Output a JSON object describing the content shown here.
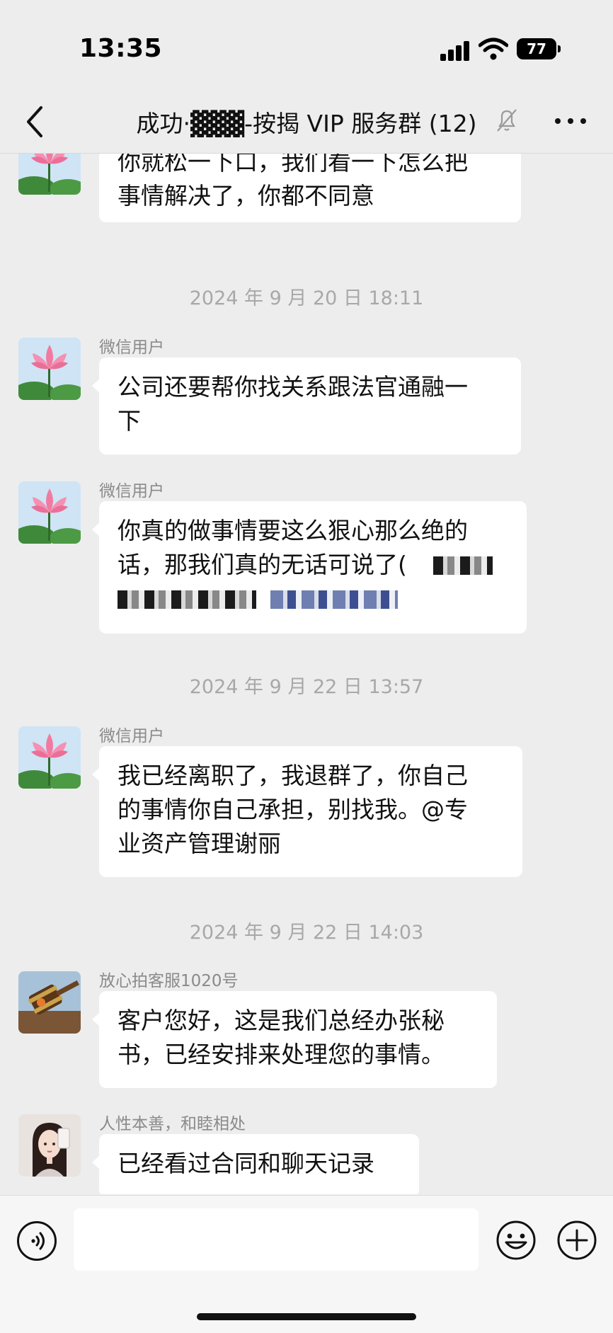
{
  "status_bar": {
    "time": "13:35",
    "battery": "77"
  },
  "nav": {
    "title": "成功·▓▓▓-按揭 VIP 服务群 (12)"
  },
  "messages": [
    {
      "sender": "",
      "lines": [
        "你就松一下口，我们看一下怎么把",
        "事情解决了，你都不同意"
      ]
    },
    {
      "timestamp": "2024 年 9 月 20 日 18:11"
    },
    {
      "sender": "微信用户",
      "lines": [
        "公司还要帮你找关系跟法官通融一",
        "下"
      ]
    },
    {
      "sender": "微信用户",
      "lines": [
        "你真的做事情要这么狠心那么绝的",
        "话，那我们真的无话可说了("
      ]
    },
    {
      "timestamp": "2024 年 9 月 22 日 13:57"
    },
    {
      "sender": "微信用户",
      "lines": [
        "我已经离职了，我退群了，你自己",
        "的事情你自己承担，别找我。@专",
        "业资产管理谢丽"
      ]
    },
    {
      "timestamp": "2024 年 9 月 22 日 14:03"
    },
    {
      "sender": "放心拍客服1020号",
      "lines": [
        "客户您好，这是我们总经办张秘",
        "书，已经安排来处理您的事情。"
      ]
    },
    {
      "sender": "人性本善，和睦相处",
      "lines": [
        "已经看过合同和聊天记录"
      ]
    }
  ],
  "input": {
    "placeholder": ""
  },
  "icons": {
    "back": "back-arrow-icon",
    "mute": "bell-off-icon",
    "more": "more-dots-icon",
    "voice": "voice-icon",
    "emoji": "emoji-icon",
    "plus": "plus-icon"
  }
}
